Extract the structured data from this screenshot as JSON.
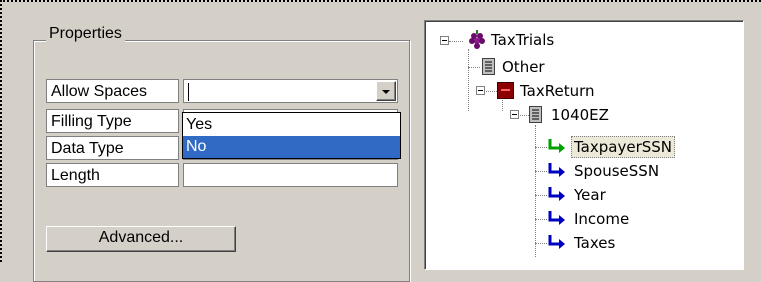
{
  "properties": {
    "group_title": "Properties",
    "rows": [
      {
        "label": "Allow Spaces",
        "value": ""
      },
      {
        "label": "Filling Type",
        "value": ""
      },
      {
        "label": "Data Type",
        "value": ""
      },
      {
        "label": "Length",
        "value": ""
      }
    ],
    "dropdown_options": [
      "Yes",
      "No"
    ],
    "selected_option": "No",
    "advanced_label": "Advanced..."
  },
  "tree": {
    "nodes": [
      {
        "label": "TaxTrials",
        "icon": "grapes-icon"
      },
      {
        "label": "Other",
        "icon": "document-icon"
      },
      {
        "label": "TaxReturn",
        "icon": "folder-red-icon"
      },
      {
        "label": "1040EZ",
        "icon": "document-icon"
      },
      {
        "label": "TaxpayerSSN",
        "icon": "green-arrow-icon"
      },
      {
        "label": "SpouseSSN",
        "icon": "blue-arrow-icon"
      },
      {
        "label": "Year",
        "icon": "blue-arrow-icon"
      },
      {
        "label": "Income",
        "icon": "blue-arrow-icon"
      },
      {
        "label": "Taxes",
        "icon": "blue-arrow-icon"
      }
    ],
    "selected": "TaxpayerSSN"
  },
  "colors": {
    "background": "#d4d0c8",
    "selection": "#316ac5",
    "arrow_green": "#00a000",
    "arrow_blue": "#0000c0"
  }
}
